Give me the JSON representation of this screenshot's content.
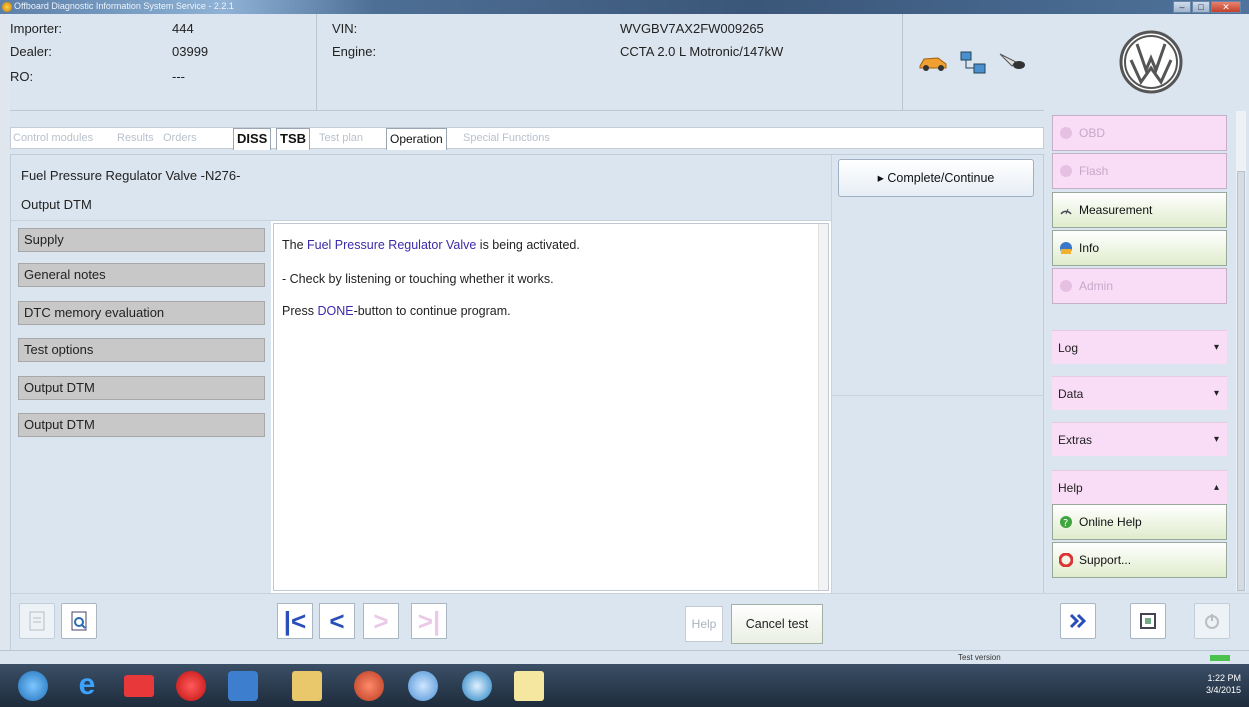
{
  "window": {
    "title": "Offboard Diagnostic Information System Service - 2.2.1"
  },
  "header": {
    "importer_label": "Importer:",
    "importer_value": "444",
    "dealer_label": "Dealer:",
    "dealer_value": "03999",
    "ro_label": "RO:",
    "ro_value": "---",
    "vin_label": "VIN:",
    "vin_value": "WVGBV7AX2FW009265",
    "engine_label": "Engine:",
    "engine_value": "CCTA 2.0 L Motronic/147kW"
  },
  "tabs": [
    {
      "label": "Control modules",
      "state": "disabled"
    },
    {
      "label": "Results",
      "state": "disabled"
    },
    {
      "label": "Orders",
      "state": "disabled"
    },
    {
      "label": "DISS",
      "state": "active"
    },
    {
      "label": "TSB",
      "state": "active"
    },
    {
      "label": "Test plan",
      "state": "disabled"
    },
    {
      "label": "Operation",
      "state": "selected"
    },
    {
      "label": "Special Functions",
      "state": "disabled"
    }
  ],
  "panel": {
    "title": "Fuel Pressure Regulator Valve -N276-",
    "subtitle": "Output DTM"
  },
  "nav_items": [
    "Supply",
    "General notes",
    "DTC memory evaluation",
    "Test options",
    "Output DTM",
    "Output DTM"
  ],
  "content": {
    "line1_pre": "The ",
    "line1_link": "Fuel Pressure Regulator Valve",
    "line1_post": " is being activated.",
    "line2": "- Check by listening or touching whether it works.",
    "line3_pre": "Press ",
    "line3_link": "DONE",
    "line3_post": "-button to continue program."
  },
  "buttons": {
    "complete": "Complete/Continue",
    "help": "Help",
    "cancel": "Cancel test"
  },
  "sidebar": {
    "obd": "OBD",
    "flash": "Flash",
    "measurement": "Measurement",
    "info": "Info",
    "admin": "Admin",
    "log": "Log",
    "data": "Data",
    "extras": "Extras",
    "help": "Help",
    "online_help": "Online Help",
    "support": "Support..."
  },
  "status": {
    "version": "Test version"
  },
  "tray": {
    "time": "1:22 PM",
    "date": "3/4/2015"
  },
  "colors": {
    "accent_blue": "#3b2aa8",
    "panel_bg": "#dbe5ef",
    "sidebar_pink": "#f9dcf6"
  }
}
